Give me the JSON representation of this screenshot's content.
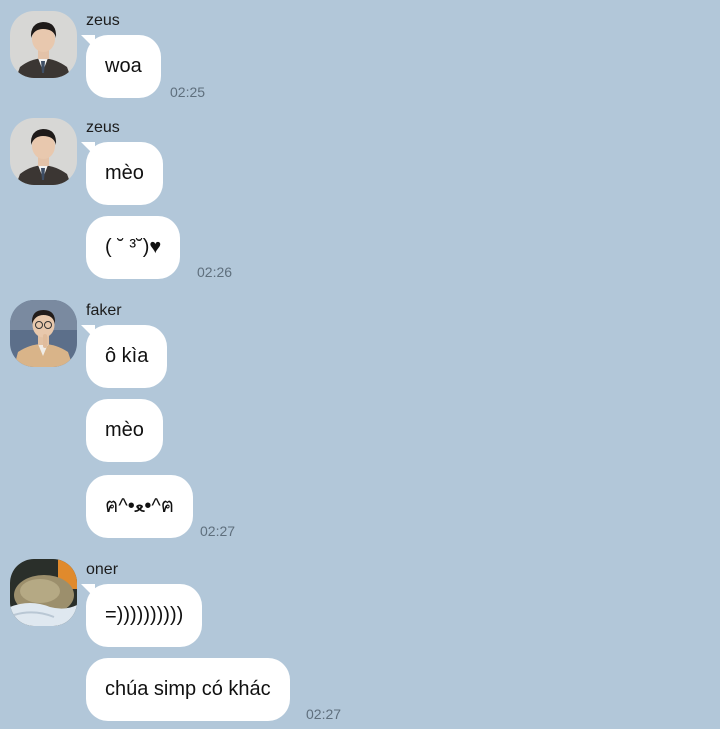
{
  "messages": [
    {
      "sender": "zeus",
      "avatar_icon": "profile-photo-man-suit",
      "bubbles": [
        "woa"
      ],
      "time": "02:25"
    },
    {
      "sender": "zeus",
      "avatar_icon": "profile-photo-man-suit",
      "bubbles": [
        "mèo",
        "( ˘ ³˘)♥"
      ],
      "time": "02:26"
    },
    {
      "sender": "faker",
      "avatar_icon": "profile-photo-man-glasses",
      "bubbles": [
        "ô kìa",
        "mèo",
        "ฅ^•ﻌ•^ฅ"
      ],
      "time": "02:27"
    },
    {
      "sender": "oner",
      "avatar_icon": "profile-photo-cat",
      "bubbles": [
        "=))))))))))",
        "chúa simp có khác"
      ],
      "time": "02:27"
    }
  ],
  "colors": {
    "background": "#b2c7d9",
    "bubble": "#ffffff",
    "time_text": "#5f6f7d"
  }
}
